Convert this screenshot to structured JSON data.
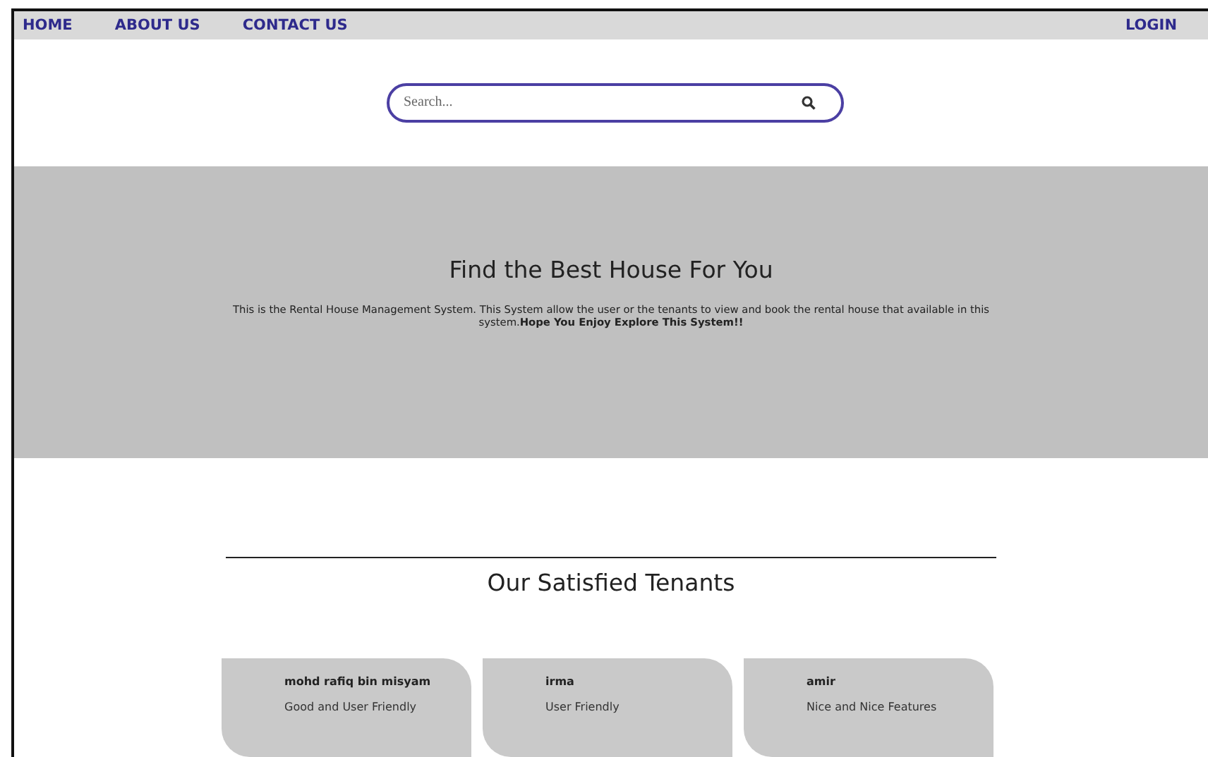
{
  "nav": {
    "links": [
      {
        "label": "HOME"
      },
      {
        "label": "ABOUT US"
      },
      {
        "label": "CONTACT US"
      }
    ],
    "login": "LOGIN"
  },
  "search": {
    "placeholder": "Search..."
  },
  "hero": {
    "title": "Find the Best House For You",
    "text": "This is the Rental House Management System. This System allow the user or the tenants to view and book the rental house that available in this system.**Hope You Enjoy Explore This System!!**"
  },
  "testimonials": {
    "heading": "Our Satisfied Tenants",
    "items": [
      {
        "name": "mohd rafiq bin misyam",
        "comment": "Good and User Friendly"
      },
      {
        "name": "irma",
        "comment": "User Friendly"
      },
      {
        "name": "amir",
        "comment": "Nice and Nice Features"
      }
    ]
  }
}
